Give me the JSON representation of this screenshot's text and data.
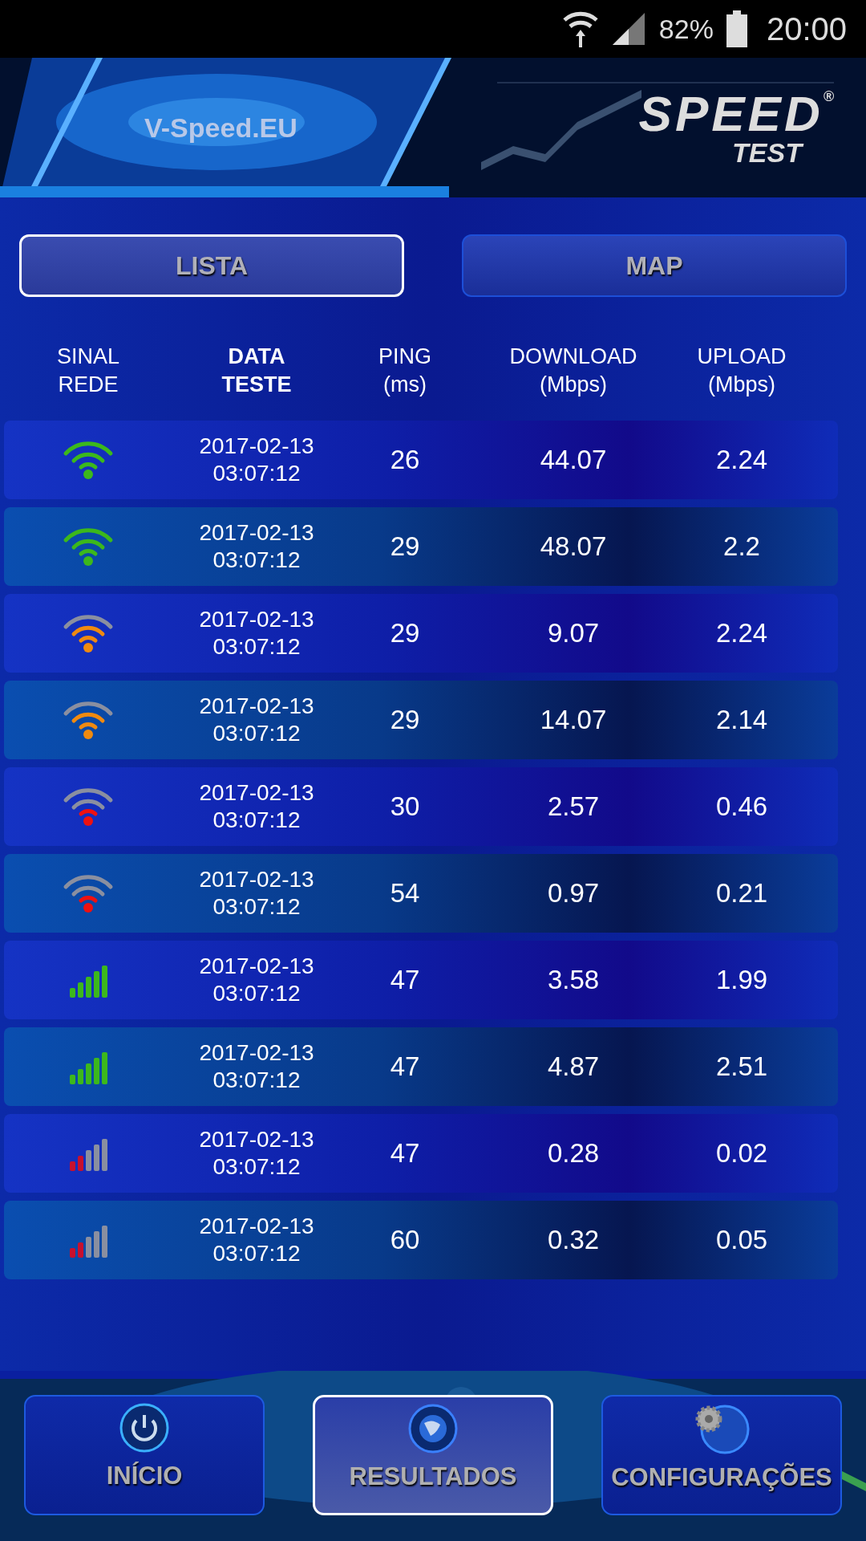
{
  "status_bar": {
    "battery": "82%",
    "time": "20:00"
  },
  "header": {
    "brand": "V-Speed.EU",
    "logo_main": "SPEED",
    "logo_mark": "®",
    "logo_sub": "TEST"
  },
  "tabs": [
    {
      "label": "LISTA",
      "selected": true
    },
    {
      "label": "MAP",
      "selected": false
    }
  ],
  "table": {
    "columns": [
      {
        "label": "SINAL\nREDE",
        "selected": false
      },
      {
        "label": "DATA\nTESTE",
        "selected": true
      },
      {
        "label": "PING\n(ms)",
        "selected": false
      },
      {
        "label": "DOWNLOAD\n(Mbps)",
        "selected": false
      },
      {
        "label": "UPLOAD\n(Mbps)",
        "selected": false
      }
    ],
    "rows": [
      {
        "signal": {
          "kind": "wifistrong",
          "color": "#3cb81c"
        },
        "date": "2017-02-13",
        "time": "03:07:12",
        "ping": "26",
        "download": "44.07",
        "upload": "2.24"
      },
      {
        "signal": {
          "kind": "wifistrong",
          "color": "#3cb81c"
        },
        "date": "2017-02-13",
        "time": "03:07:12",
        "ping": "29",
        "download": "48.07",
        "upload": "2.2"
      },
      {
        "signal": {
          "kind": "wifimedium",
          "color": "#f08a10"
        },
        "date": "2017-02-13",
        "time": "03:07:12",
        "ping": "29",
        "download": "9.07",
        "upload": "2.24"
      },
      {
        "signal": {
          "kind": "wifimedium",
          "color": "#f08a10"
        },
        "date": "2017-02-13",
        "time": "03:07:12",
        "ping": "29",
        "download": "14.07",
        "upload": "2.14"
      },
      {
        "signal": {
          "kind": "wifiweak",
          "color": "#ee1111"
        },
        "date": "2017-02-13",
        "time": "03:07:12",
        "ping": "30",
        "download": "2.57",
        "upload": "0.46"
      },
      {
        "signal": {
          "kind": "wifiweak",
          "color": "#ee1111"
        },
        "date": "2017-02-13",
        "time": "03:07:12",
        "ping": "54",
        "download": "0.97",
        "upload": "0.21"
      },
      {
        "signal": {
          "kind": "barsstrong",
          "color": "#3cb81c"
        },
        "date": "2017-02-13",
        "time": "03:07:12",
        "ping": "47",
        "download": "3.58",
        "upload": "1.99"
      },
      {
        "signal": {
          "kind": "barsstrong",
          "color": "#3cb81c"
        },
        "date": "2017-02-13",
        "time": "03:07:12",
        "ping": "47",
        "download": "4.87",
        "upload": "2.51"
      },
      {
        "signal": {
          "kind": "barsweak",
          "color": "#c8102e"
        },
        "date": "2017-02-13",
        "time": "03:07:12",
        "ping": "47",
        "download": "0.28",
        "upload": "0.02"
      },
      {
        "signal": {
          "kind": "barsweak",
          "color": "#c8102e"
        },
        "date": "2017-02-13",
        "time": "03:07:12",
        "ping": "60",
        "download": "0.32",
        "upload": "0.05"
      }
    ]
  },
  "bottom_nav": [
    {
      "label": "INÍCIO",
      "kind": "power",
      "selected": false
    },
    {
      "label": "RESULTADOS",
      "kind": "globe",
      "selected": true
    },
    {
      "label": "CONFIGURAÇÕES",
      "kind": "gear",
      "selected": false
    }
  ]
}
